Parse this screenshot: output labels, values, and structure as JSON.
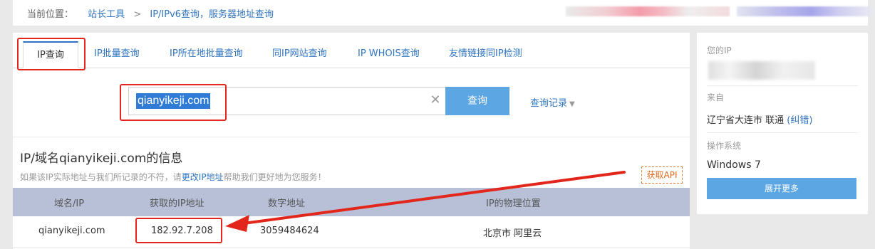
{
  "breadcrumb": {
    "prefix": "当前位置：",
    "home": "站长工具",
    "separator": ">",
    "current": "IP/IPv6查询，服务器地址查询"
  },
  "tabs": [
    {
      "label": "IP查询",
      "active": true
    },
    {
      "label": "IP批量查询"
    },
    {
      "label": "IP所在地批量查询"
    },
    {
      "label": "同IP网站查询"
    },
    {
      "label": "IP WHOIS查询"
    },
    {
      "label": "友情链接同IP检测"
    }
  ],
  "search": {
    "value": "qianyikeji.com",
    "button_label": "查询",
    "history_label": "查询记录",
    "clear_icon": "close-icon"
  },
  "result": {
    "title": "IP/域名qianyikeji.com的信息",
    "notice_before": "如果该IP实际地址与我们所记录的不符，请",
    "notice_link": "更改IP地址",
    "notice_after": "帮助我们更好地为您服务！",
    "api_label": "获取API"
  },
  "table": {
    "headers": [
      "域名/IP",
      "获取的IP地址",
      "数字地址",
      "IP的物理位置"
    ],
    "rows": [
      [
        "qianyikeji.com",
        "182.92.7.208",
        "3059484624",
        "北京市 阿里云"
      ]
    ]
  },
  "sidebar": {
    "your_ip_label": "您的IP",
    "from_label": "来自",
    "from_value": "辽宁省大连市 联通",
    "correct_link": "(纠错)",
    "os_label": "操作系统",
    "os_value": "Windows 7",
    "expand_label": "展开更多"
  },
  "colors": {
    "accent": "#2f74c0",
    "button": "#5ba6e3",
    "annotation_red": "#e3261b",
    "table_header": "#b8c0d8"
  }
}
